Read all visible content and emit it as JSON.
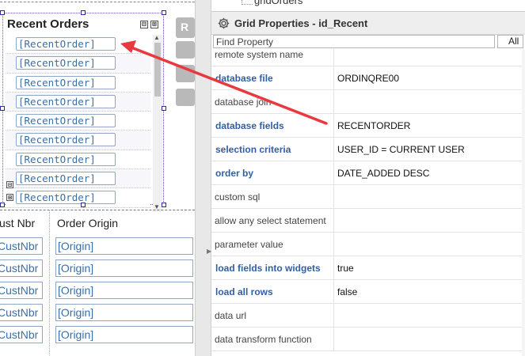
{
  "designer": {
    "grid_title": "Recent Orders",
    "collapse_glyph": "⊟",
    "expand_glyph": "⊞",
    "row_placeholder": "[RecentOrder]",
    "row_count": 9,
    "gray_button_letter": "R",
    "lower_grid": {
      "headers": [
        "ust Nbr",
        "Order Origin"
      ],
      "cust_placeholder": "CustNbr",
      "origin_placeholder": "[Origin]",
      "row_count": 5
    }
  },
  "properties": {
    "tree_peek_label": "gridOrders",
    "title": "Grid Properties - id_Recent",
    "find_placeholder": "Find Property",
    "all_button": "All",
    "rows": [
      {
        "name": "remote system name",
        "value": "",
        "set": false
      },
      {
        "name": "database file",
        "value": "ORDINQRE00",
        "set": true
      },
      {
        "name": "database join",
        "value": "",
        "set": false
      },
      {
        "name": "database fields",
        "value": "RECENTORDER",
        "set": true
      },
      {
        "name": "selection criteria",
        "value": "USER_ID = CURRENT USER",
        "set": true
      },
      {
        "name": "order by",
        "value": "DATE_ADDED DESC",
        "set": true
      },
      {
        "name": "custom sql",
        "value": "",
        "set": false
      },
      {
        "name": "allow any select statement",
        "value": "",
        "set": false
      },
      {
        "name": "parameter value",
        "value": "",
        "set": false
      },
      {
        "name": "load fields into widgets",
        "value": "true",
        "set": true
      },
      {
        "name": "load all rows",
        "value": "false",
        "set": true
      },
      {
        "name": "data url",
        "value": "",
        "set": false
      },
      {
        "name": "data transform function",
        "value": "",
        "set": false
      }
    ]
  },
  "colors": {
    "accent_property": "#2f5fa8",
    "arrow": "#e8393f",
    "chip_text": "#3a6fa8",
    "chip_border": "#8fa7c7"
  },
  "icons": {
    "header": "gear-icon",
    "annotation": "red-arrow"
  }
}
